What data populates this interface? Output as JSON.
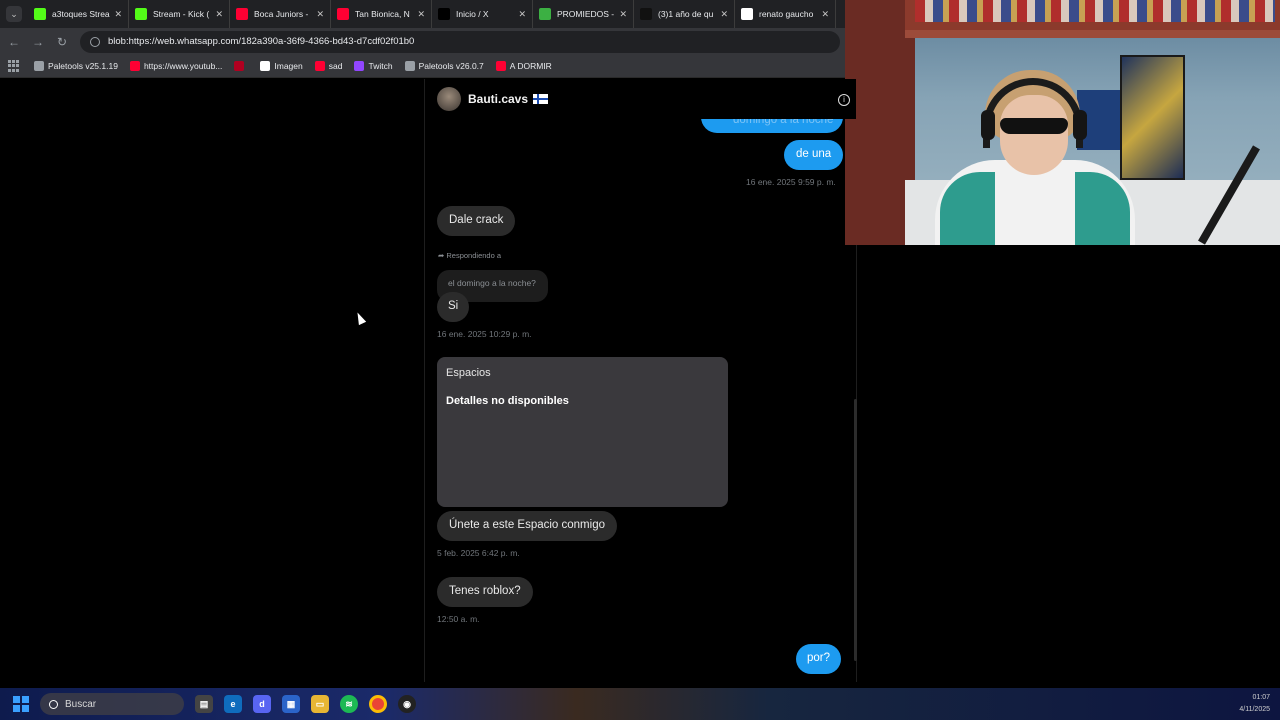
{
  "browser": {
    "tabs": [
      {
        "title": "a3toques Strea",
        "icon": "kick-icon",
        "color": "#53fc18"
      },
      {
        "title": "Stream - Kick (",
        "icon": "kick-icon",
        "color": "#53fc18"
      },
      {
        "title": "Boca Juniors -",
        "icon": "youtube-icon",
        "color": "#ff0033"
      },
      {
        "title": "Tan Bionica, N",
        "icon": "youtube-icon",
        "color": "#ff0033"
      },
      {
        "title": "Inicio / X",
        "icon": "x-icon",
        "color": "#000000"
      },
      {
        "title": "PROMIEDOS -",
        "icon": "promiedos-icon",
        "color": "#3cb043"
      },
      {
        "title": "(3)1 año de qu",
        "icon": "tiktok-icon",
        "color": "#111111"
      },
      {
        "title": "renato gaucho",
        "icon": "google-icon",
        "color": "#ffffff"
      }
    ],
    "url": "blob:https://web.whatsapp.com/182a390a-36f9-4366-bd43-d7cdf02f01b0",
    "bookmarks": [
      {
        "label": "Paletools v25.1.19",
        "icon": "globe-icon",
        "color": "#9aa0a6"
      },
      {
        "label": "https://www.youtub...",
        "icon": "youtube-icon",
        "color": "#ff0033"
      },
      {
        "label": "",
        "icon": "circle-icon",
        "color": "#b00020"
      },
      {
        "label": "Imagen",
        "icon": "x-icon",
        "color": "#ffffff"
      },
      {
        "label": "sad",
        "icon": "youtube-icon",
        "color": "#ff0033"
      },
      {
        "label": "Twitch",
        "icon": "twitch-icon",
        "color": "#9146ff"
      },
      {
        "label": "Paletools v26.0.7",
        "icon": "globe-icon",
        "color": "#9aa0a6"
      },
      {
        "label": "A DORMIR",
        "icon": "youtube-icon",
        "color": "#ff0033"
      }
    ]
  },
  "chat": {
    "name": "Bauti.cavs",
    "messages": {
      "partial_top": "domingo a la noche",
      "de_una": "de una",
      "time_1": "16 ene. 2025 9:59 p. m.",
      "dale_crack": "Dale crack",
      "reply_label": "Respondiendo a",
      "quoted": "el domingo a la noche?",
      "si": "Si",
      "time_2": "16 ene. 2025 10:29 p. m.",
      "card_title": "Espacios",
      "card_sub": "Detalles no disponibles",
      "join_space": "Únete a este Espacio conmigo",
      "time_3": "5 feb. 2025 6:42 p. m.",
      "roblox": "Tenes roblox?",
      "time_4": "12:50 a. m.",
      "por": "por?"
    }
  },
  "taskbar": {
    "search_placeholder": "Buscar",
    "clock_time": "01:07",
    "clock_date": "4/11/2025"
  }
}
